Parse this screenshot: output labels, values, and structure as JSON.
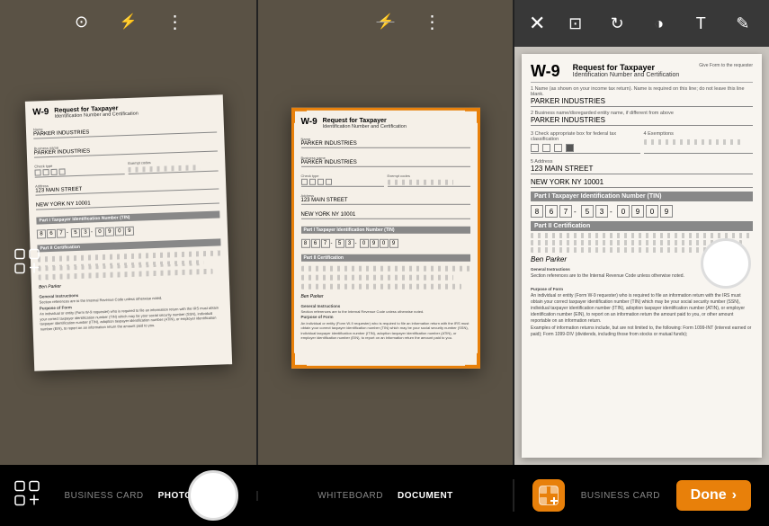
{
  "panels": {
    "left": {
      "mode_labels": [
        "BUSINESS CARD",
        "PHOTO"
      ],
      "active_mode": "PHOTO"
    },
    "middle": {
      "mode_labels": [
        "WHITEBOARD",
        "DOCUMENT"
      ],
      "active_mode": "DOCUMENT"
    },
    "right": {
      "mode_label": "BUSINESS CARD",
      "done_label": "Done"
    }
  },
  "toolbar": {
    "close_icon": "✕",
    "crop_icon": "⊡",
    "rotate_icon": "↻",
    "filter_icon": "◑",
    "text_icon": "T",
    "edit_icon": "✎"
  },
  "form": {
    "badge": "W-9",
    "title": "Request for Taxpayer",
    "subtitle": "Identification Number and Certification",
    "name_label": "1 Name (as shown on your income tax return). Name is required on this line; do not leave this line blank.",
    "name_value": "PARKER INDUSTRIES",
    "biz_label": "2 Business name/disregarded entity name, if different from above",
    "biz_value": "PARKER INDUSTRIES",
    "address_label": "3 Check appropriate box",
    "address_value": "123 MAIN STREET",
    "city_value": "NEW YORK NY 10001",
    "ssn_values": [
      "8",
      "6",
      "7",
      "5",
      "3",
      "0",
      "9"
    ],
    "signature": "Ben Parker",
    "part1_label": "Part I  Taxpayer Identification Number (TIN)",
    "part2_label": "Part II  Certification",
    "instructions_title": "General Instructions",
    "purpose_title": "Purpose of Form"
  },
  "icons": {
    "camera_icon": "⊙",
    "flash_icon": "⚡",
    "more_icon": "⋮",
    "scan_plus": "+"
  }
}
